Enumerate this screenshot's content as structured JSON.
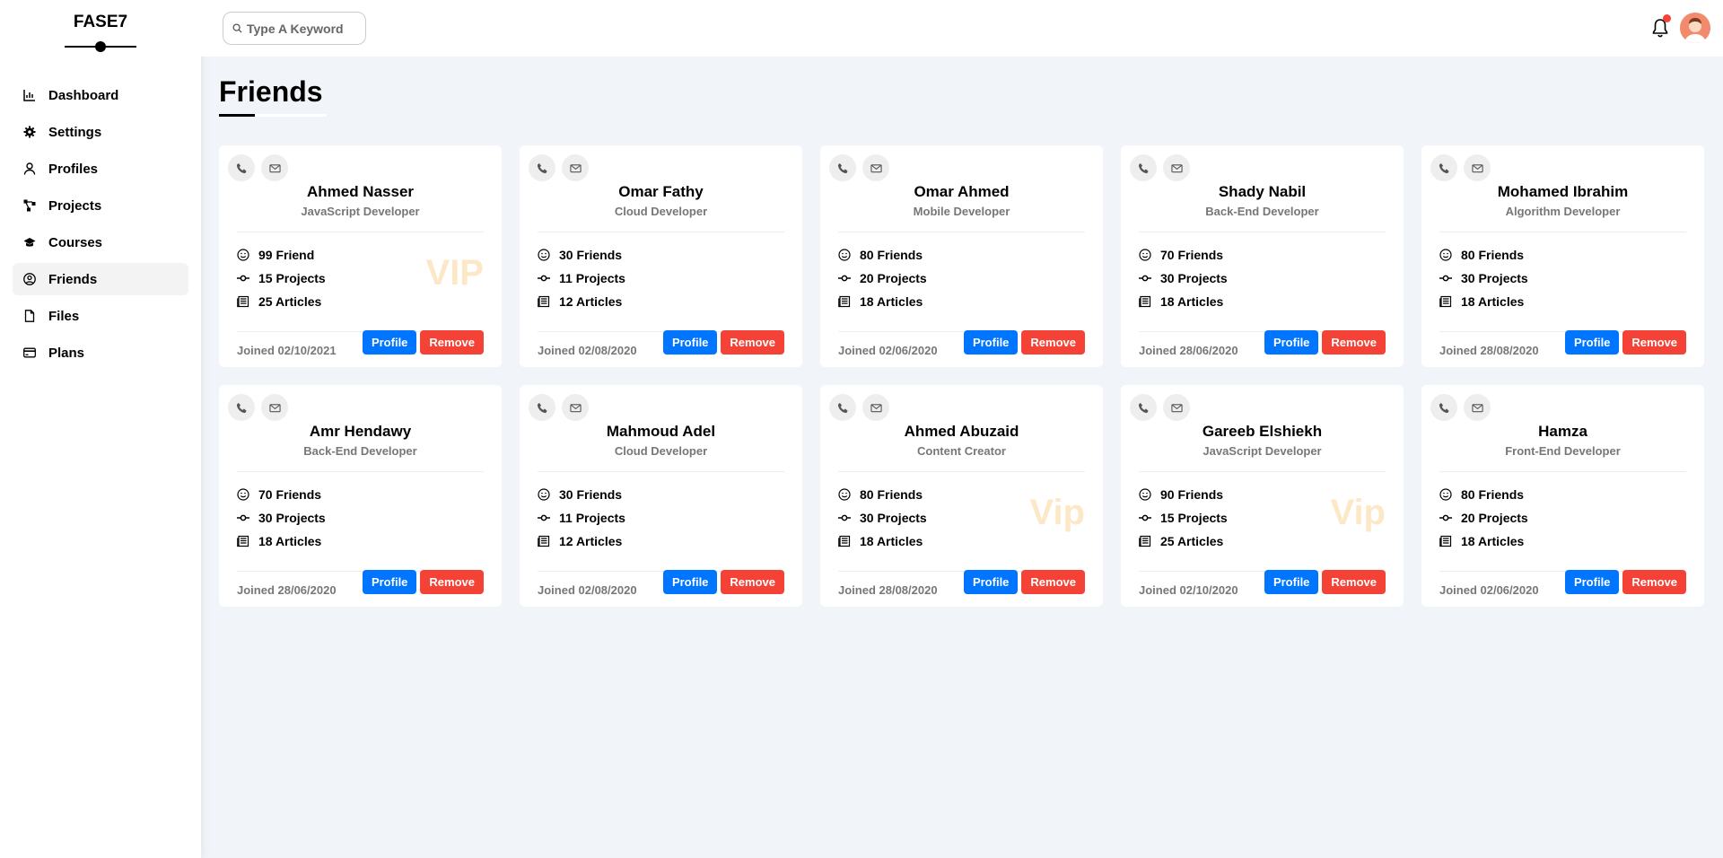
{
  "brand": "FASE7",
  "sidebar": {
    "items": [
      {
        "label": "Dashboard",
        "icon": "chart-icon"
      },
      {
        "label": "Settings",
        "icon": "gear-icon"
      },
      {
        "label": "Profiles",
        "icon": "user-icon"
      },
      {
        "label": "Projects",
        "icon": "diagram-icon"
      },
      {
        "label": "Courses",
        "icon": "graduation-cap-icon"
      },
      {
        "label": "Friends",
        "icon": "user-circle-icon",
        "active": true
      },
      {
        "label": "Files",
        "icon": "file-icon"
      },
      {
        "label": "Plans",
        "icon": "credit-card-icon"
      }
    ]
  },
  "header": {
    "search_placeholder": "Type A Keyword",
    "notification_dot_color": "#f44336"
  },
  "page_title": "Friends",
  "colors": {
    "profile_button": "#0075ff",
    "remove_button": "#f44336",
    "vip": "#f5a623"
  },
  "buttons": {
    "profile": "Profile",
    "remove": "Remove"
  },
  "friends": [
    {
      "name": "Ahmed Nasser",
      "role": "JavaScript Developer",
      "friends": "99 Friend",
      "projects": "15 Projects",
      "articles": "25 Articles",
      "joined": "Joined 02/10/2021",
      "vip": "VIP"
    },
    {
      "name": "Omar Fathy",
      "role": "Cloud Developer",
      "friends": "30 Friends",
      "projects": "11 Projects",
      "articles": "12 Articles",
      "joined": "Joined 02/08/2020",
      "vip": ""
    },
    {
      "name": "Omar Ahmed",
      "role": "Mobile Developer",
      "friends": "80 Friends",
      "projects": "20 Projects",
      "articles": "18 Articles",
      "joined": "Joined 02/06/2020",
      "vip": ""
    },
    {
      "name": "Shady Nabil",
      "role": "Back-End Developer",
      "friends": "70 Friends",
      "projects": "30 Projects",
      "articles": "18 Articles",
      "joined": "Joined 28/06/2020",
      "vip": ""
    },
    {
      "name": "Mohamed Ibrahim",
      "role": "Algorithm Developer",
      "friends": "80 Friends",
      "projects": "30 Projects",
      "articles": "18 Articles",
      "joined": "Joined 28/08/2020",
      "vip": ""
    },
    {
      "name": "Amr Hendawy",
      "role": "Back-End Developer",
      "friends": "70 Friends",
      "projects": "30 Projects",
      "articles": "18 Articles",
      "joined": "Joined 28/06/2020",
      "vip": ""
    },
    {
      "name": "Mahmoud Adel",
      "role": "Cloud Developer",
      "friends": "30 Friends",
      "projects": "11 Projects",
      "articles": "12 Articles",
      "joined": "Joined 02/08/2020",
      "vip": ""
    },
    {
      "name": "Ahmed Abuzaid",
      "role": "Content Creator",
      "friends": "80 Friends",
      "projects": "30 Projects",
      "articles": "18 Articles",
      "joined": "Joined 28/08/2020",
      "vip": "Vip"
    },
    {
      "name": "Gareeb Elshiekh",
      "role": "JavaScript Developer",
      "friends": "90 Friends",
      "projects": "15 Projects",
      "articles": "25 Articles",
      "joined": "Joined 02/10/2020",
      "vip": "Vip"
    },
    {
      "name": "Hamza",
      "role": "Front-End Developer",
      "friends": "80 Friends",
      "projects": "20 Projects",
      "articles": "18 Articles",
      "joined": "Joined 02/06/2020",
      "vip": ""
    }
  ]
}
